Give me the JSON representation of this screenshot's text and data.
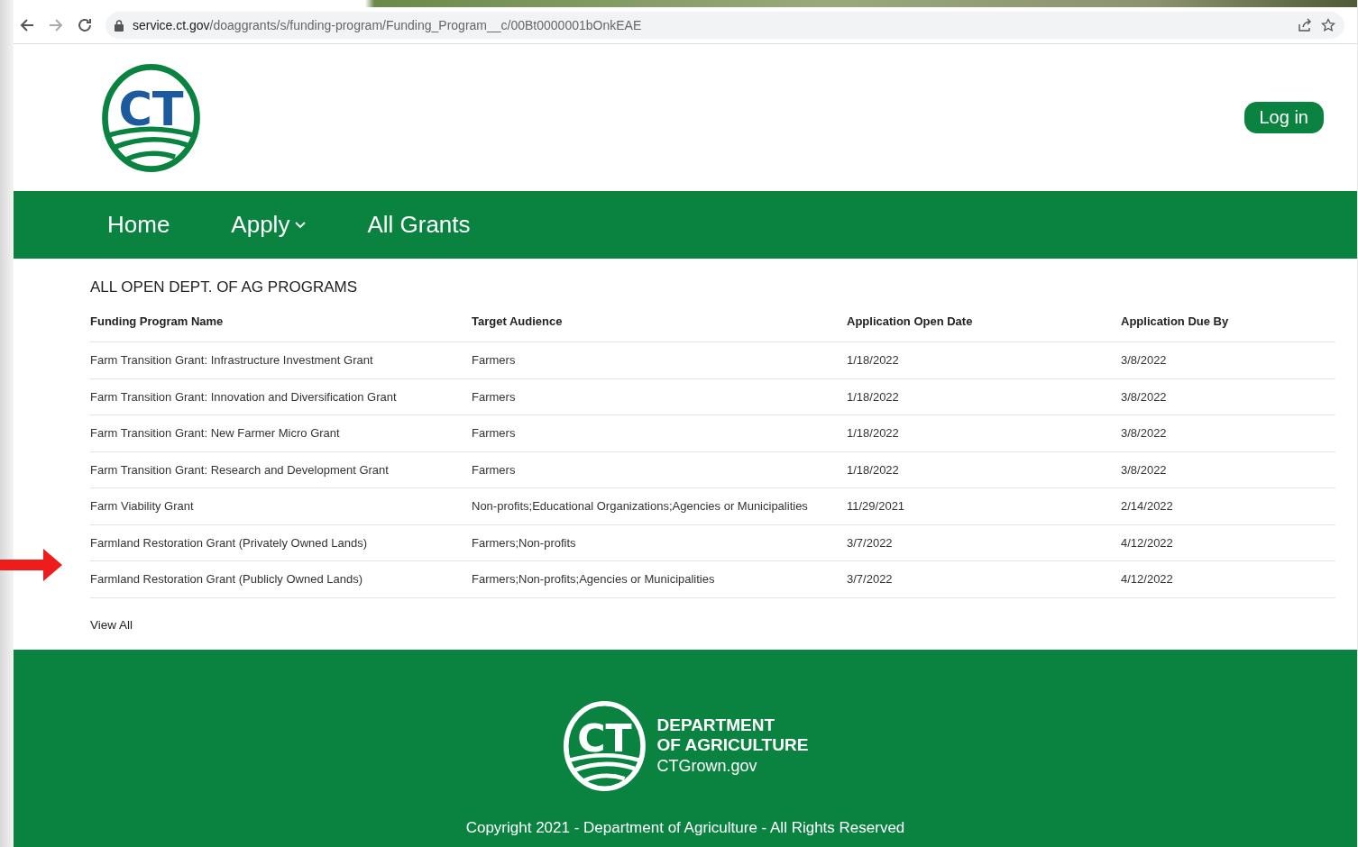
{
  "browser": {
    "url_host": "service.ct.gov",
    "url_path": "/doaggrants/s/funding-program/Funding_Program__c/00Bt0000001bOnkEAE"
  },
  "header": {
    "logo_text": "CT",
    "login_button": "Log in"
  },
  "nav": [
    {
      "label": "Home",
      "dropdown": false
    },
    {
      "label": "Apply",
      "dropdown": true
    },
    {
      "label": "All Grants",
      "dropdown": false
    }
  ],
  "section_title": "ALL OPEN DEPT. OF AG PROGRAMS",
  "table": {
    "columns": [
      "Funding Program Name",
      "Target Audience",
      "Application Open Date",
      "Application Due By"
    ],
    "rows": [
      {
        "cells": [
          "Farm Transition Grant: Infrastructure Investment Grant",
          "Farmers",
          "1/18/2022",
          "3/8/2022"
        ],
        "highlighted": false
      },
      {
        "cells": [
          "Farm Transition Grant: Innovation and Diversification Grant",
          "Farmers",
          "1/18/2022",
          "3/8/2022"
        ],
        "highlighted": false
      },
      {
        "cells": [
          "Farm Transition Grant: New Farmer Micro Grant",
          "Farmers",
          "1/18/2022",
          "3/8/2022"
        ],
        "highlighted": false
      },
      {
        "cells": [
          "Farm Transition Grant: Research and Development Grant",
          "Farmers",
          "1/18/2022",
          "3/8/2022"
        ],
        "highlighted": false
      },
      {
        "cells": [
          "Farm Viability Grant",
          "Non-profits;Educational Organizations;Agencies or Municipalities",
          "11/29/2021",
          "2/14/2022"
        ],
        "highlighted": false
      },
      {
        "cells": [
          "Farmland Restoration Grant (Privately Owned Lands)",
          "Farmers;Non-profits",
          "3/7/2022",
          "4/12/2022"
        ],
        "highlighted": false
      },
      {
        "cells": [
          "Farmland Restoration Grant (Publicly Owned Lands)",
          "Farmers;Non-profits;Agencies or Municipalities",
          "3/7/2022",
          "4/12/2022"
        ],
        "highlighted": true
      }
    ]
  },
  "view_all": "View All",
  "footer": {
    "logo_text": "CT",
    "dept_line_1": "DEPARTMENT",
    "dept_line_2": "OF AGRICULTURE",
    "site": "CTGrown.gov",
    "copyright": "Copyright 2021 - Department of Agriculture - All Rights Reserved"
  }
}
